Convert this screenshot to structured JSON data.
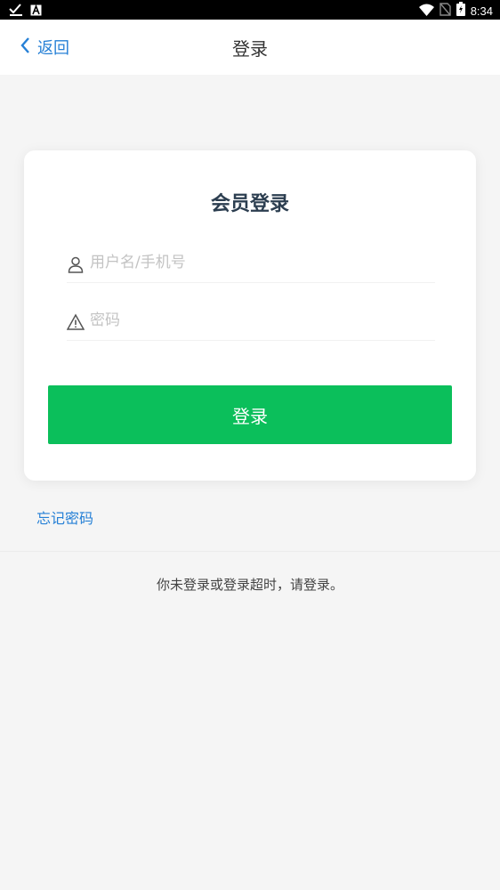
{
  "status_bar": {
    "time": "8:34",
    "icons": [
      "check-download-icon",
      "a-app-icon",
      "wifi-icon",
      "no-sim-icon",
      "battery-charging-icon"
    ]
  },
  "navbar": {
    "back_label": "返回",
    "title": "登录"
  },
  "login_card": {
    "title": "会员登录",
    "username_placeholder": "用户名/手机号",
    "password_placeholder": "密码",
    "submit_label": "登录"
  },
  "forgot_password": "忘记密码",
  "notice": "你未登录或登录超时，请登录。",
  "colors": {
    "accent_blue": "#2680d6",
    "button_green": "#0bbf5b",
    "background": "#f5f5f5"
  }
}
